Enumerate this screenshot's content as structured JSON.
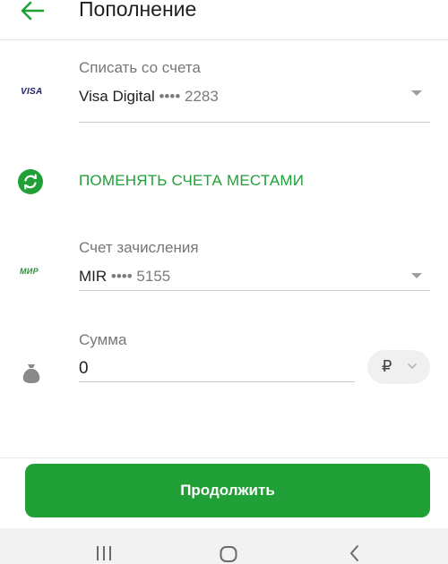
{
  "header": {
    "title": "Пополнение"
  },
  "from_account": {
    "label": "Списать со счета",
    "card_logo": "VISA",
    "card_name": "Visa Digital",
    "card_mask": "•••• 2283"
  },
  "swap": {
    "label": "ПОМЕНЯТЬ СЧЕТА МЕСТАМИ"
  },
  "to_account": {
    "label": "Счет зачисления",
    "card_logo": "МИР",
    "card_name": "MIR",
    "card_mask": "•••• 5155"
  },
  "amount": {
    "label": "Сумма",
    "value": "0",
    "currency_symbol": "₽"
  },
  "footer": {
    "continue_label": "Продолжить"
  },
  "colors": {
    "accent": "#21a038"
  }
}
